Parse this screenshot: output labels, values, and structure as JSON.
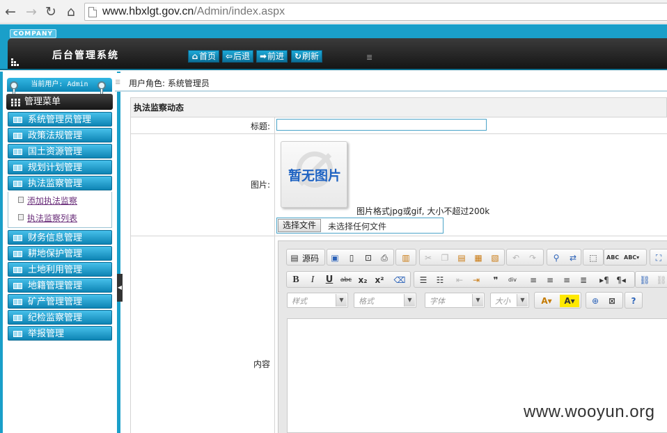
{
  "browser": {
    "back_icon": "←",
    "forward_icon": "→",
    "reload_icon": "↻",
    "home_icon": "⌂",
    "url_host": "www.hbxlgt.gov.cn",
    "url_path": "/Admin/index.aspx"
  },
  "header": {
    "company_badge": "COMPANY",
    "system_title": "后台管理系统",
    "nav": [
      {
        "icon": "⌂",
        "label": "首页"
      },
      {
        "icon": "⇦",
        "label": "后退"
      },
      {
        "icon": "➡",
        "label": "前进"
      },
      {
        "icon": "↻",
        "label": "刷新"
      }
    ],
    "grip_icon": "≣"
  },
  "sidebar": {
    "current_user": "当前用户: Admin",
    "menu_heading": "管理菜单",
    "items_top": [
      "系统管理员管理",
      "政策法规管理",
      "国土资源管理",
      "规划计划管理",
      "执法监察管理"
    ],
    "subitems": [
      "添加执法监察",
      "执法监察列表"
    ],
    "items_bottom": [
      "财务信息管理",
      "耕地保护管理",
      "土地利用管理",
      "地籍管理管理",
      "矿产管理管理",
      "纪检监察管理",
      "举报管理"
    ],
    "collapse_icon": "◀"
  },
  "content": {
    "role_text": "用户角色: 系统管理员",
    "section_title": "执法监察动态",
    "labels": {
      "title": "标题:",
      "image": "图片:",
      "content": "内容"
    },
    "title_value": "",
    "noimage_text": "暂无图片",
    "image_hint": "图片格式jpg或gif, 大小不超过200k",
    "file_button": "选择文件",
    "file_status": "未选择任何文件"
  },
  "editor": {
    "source_label": "源码",
    "combos": [
      "样式",
      "格式",
      "字体",
      "大小"
    ]
  },
  "watermark": "www.wooyun.org"
}
